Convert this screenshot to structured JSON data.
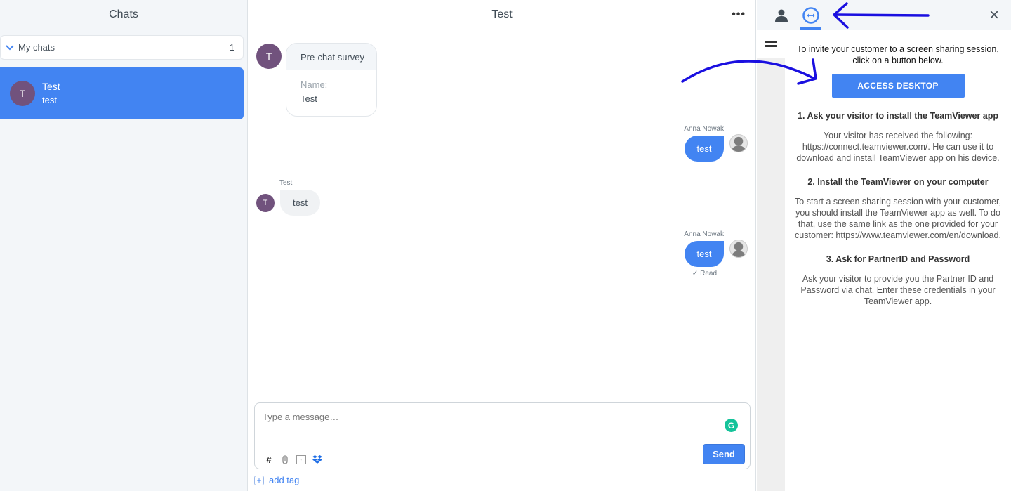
{
  "chats_panel": {
    "title": "Chats",
    "group": {
      "label": "My chats",
      "count": "1",
      "icon": "chevron-down-icon"
    },
    "items": [
      {
        "avatar_letter": "T",
        "name": "Test",
        "preview": "test",
        "selected": true,
        "avatar_color": "#71527d"
      }
    ]
  },
  "chat": {
    "title": "Test",
    "more_icon": "•••",
    "survey": {
      "avatar_letter": "T",
      "title": "Pre-chat survey",
      "field_label": "Name:",
      "field_value": "Test"
    },
    "messages": [
      {
        "side": "agent",
        "author": "Anna Nowak",
        "text": "test"
      },
      {
        "side": "visitor",
        "author": "Test",
        "avatar_letter": "T",
        "text": "test"
      },
      {
        "side": "agent",
        "author": "Anna Nowak",
        "text": "test",
        "status": "Read"
      }
    ],
    "composer": {
      "placeholder": "Type a message…",
      "send_label": "Send",
      "tools": [
        "hashtag-icon",
        "paperclip-icon",
        "canned-response-icon",
        "dropbox-icon"
      ]
    },
    "add_tag_label": "add tag"
  },
  "side_panel": {
    "tabs": [
      {
        "name": "customer-details-icon",
        "active": false
      },
      {
        "name": "teamviewer-icon",
        "active": true
      }
    ],
    "close_icon": "×",
    "intro": "To invite your customer to a screen sharing session, click on a button below.",
    "access_button": "ACCESS DESKTOP",
    "steps": [
      {
        "title": "1. Ask your visitor to install the TeamViewer app",
        "text": "Your visitor has received the following: https://connect.teamviewer.com/. He can use it to download and install TeamViewer app on his device."
      },
      {
        "title": "2. Install the TeamViewer on your computer",
        "text": "To start a screen sharing session with your customer, you should install the TeamViewer app as well. To do that, use the same link as the one provided for your customer: https://www.teamviewer.com/en/download."
      },
      {
        "title": "3. Ask for PartnerID and Password",
        "text": "Ask your visitor to provide you the Partner ID and Password via chat. Enter these credentials in your TeamViewer app."
      }
    ]
  },
  "colors": {
    "accent": "#4284f2",
    "avatar": "#71527d",
    "annotation": "#1a0fe0",
    "grammarly": "#15c39a"
  }
}
